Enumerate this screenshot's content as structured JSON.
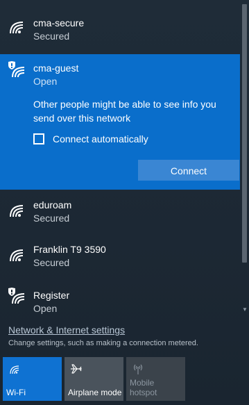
{
  "networks": [
    {
      "name": "cma-secure",
      "status": "Secured",
      "icon": "wifi-icon"
    },
    {
      "name": "cma-guest",
      "status": "Open",
      "icon": "wifi-shield-icon"
    },
    {
      "name": "eduroam",
      "status": "Secured",
      "icon": "wifi-icon"
    },
    {
      "name": "Franklin T9 3590",
      "status": "Secured",
      "icon": "wifi-icon"
    },
    {
      "name": "Register",
      "status": "Open",
      "icon": "wifi-shield-icon"
    }
  ],
  "selected_network": {
    "warning": "Other people might be able to see info you send over this network",
    "auto_connect_label": "Connect automatically",
    "auto_connect_checked": false,
    "connect_label": "Connect"
  },
  "settings": {
    "link": "Network & Internet settings",
    "description": "Change settings, such as making a connection metered."
  },
  "quick_actions": [
    {
      "label": "Wi-Fi",
      "icon": "wifi-icon",
      "state": "on"
    },
    {
      "label": "Airplane mode",
      "icon": "airplane-icon",
      "state": "off"
    },
    {
      "label": "Mobile\nhotspot",
      "icon": "hotspot-icon",
      "state": "disabled"
    }
  ],
  "colors": {
    "accent": "#0a6ecb",
    "button": "#3a86d3",
    "background": "#1e2a36"
  }
}
